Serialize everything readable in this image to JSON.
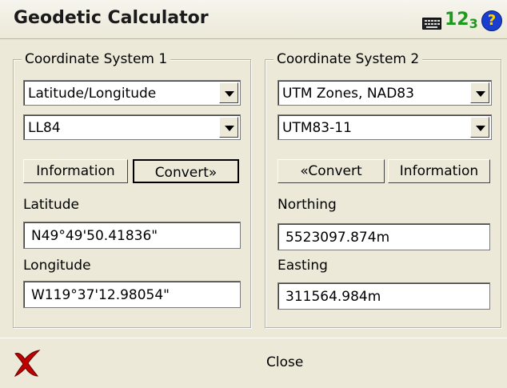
{
  "window": {
    "title": "Geodetic Calculator"
  },
  "titlebar": {
    "keyboard_icon": "keyboard-icon",
    "numeric_label": "12",
    "numeric_sub": "3",
    "help_label": "?"
  },
  "system1": {
    "title": "Coordinate System 1",
    "type_value": "Latitude/Longitude",
    "code_value": "LL84",
    "info_label": "Information",
    "convert_label": "Convert»",
    "field1_label": "Latitude",
    "field1_value": "N49°49'50.41836\"",
    "field2_label": "Longitude",
    "field2_value": "W119°37'12.98054\""
  },
  "system2": {
    "title": "Coordinate System 2",
    "type_value": "UTM Zones, NAD83",
    "code_value": "UTM83-11",
    "convert_label": "«Convert",
    "info_label": "Information",
    "field1_label": "Northing",
    "field1_value": "5523097.874m",
    "field2_label": "Easting",
    "field2_value": "311564.984m"
  },
  "footer": {
    "close_label": "Close"
  },
  "colors": {
    "accent_green": "#1d9a1d",
    "help_blue": "#1a3fd0",
    "close_red": "#c00000"
  }
}
